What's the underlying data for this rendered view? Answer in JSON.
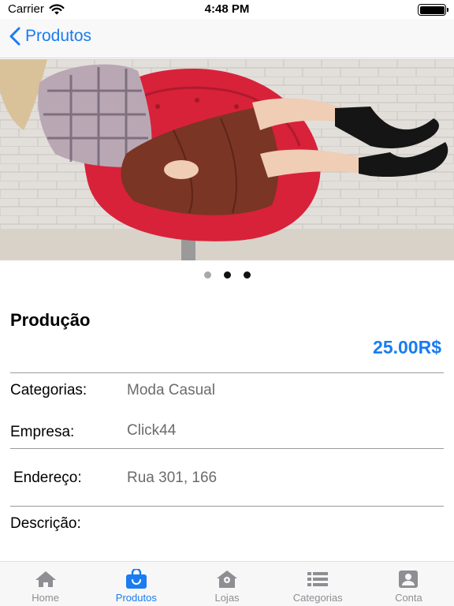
{
  "status_bar": {
    "carrier": "Carrier",
    "time": "4:48 PM",
    "battery_level": 1.0
  },
  "nav": {
    "back_label": "Produtos"
  },
  "carousel": {
    "page_count": 3,
    "current_page": 0
  },
  "product": {
    "title": "Produção",
    "price": "25.00R$"
  },
  "details": {
    "categorias_label": "Categorias:",
    "categorias_value": "Moda Casual",
    "empresa_label": "Empresa:",
    "empresa_value": "Click44",
    "endereco_label": "Endereço:",
    "endereco_value": "Rua 301, 166",
    "descricao_label": "Descrição:"
  },
  "tabs": [
    {
      "label": "Home",
      "icon": "home-icon"
    },
    {
      "label": "Produtos",
      "icon": "shopping-bag-icon",
      "active": true
    },
    {
      "label": "Lojas",
      "icon": "store-icon"
    },
    {
      "label": "Categorias",
      "icon": "list-icon"
    },
    {
      "label": "Conta",
      "icon": "account-icon"
    }
  ],
  "colors": {
    "accent": "#1a7cf0",
    "tab_inactive": "#8e8e93",
    "value_text": "#6b6b6b"
  }
}
